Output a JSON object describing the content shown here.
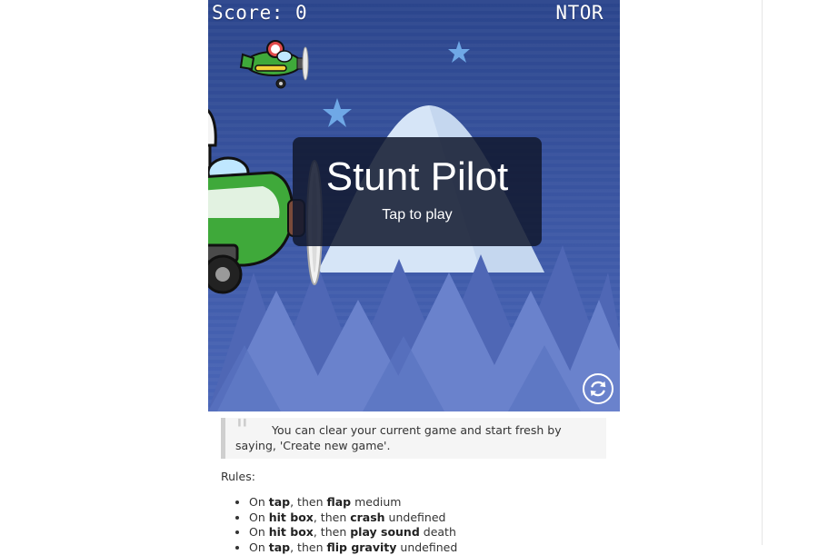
{
  "game": {
    "score_text": "Score: 0",
    "tag": "NTOR",
    "title": "Stunt Pilot",
    "subtitle": "Tap to play",
    "colors": {
      "sky_top": "#2b458c",
      "sky_bottom": "#4a66b8",
      "mountain": "#cfe0f5",
      "tree_dark": "#4f67b5",
      "tree_light": "#6a82cc",
      "star": "#6fa8e6",
      "plane_body": "#3fa93a",
      "panel": "#11182e"
    },
    "reset_icon": "refresh-icon"
  },
  "note": {
    "text": "You can clear your current game and start fresh by saying, 'Create new game'."
  },
  "rules": {
    "label": "Rules:",
    "items": [
      {
        "prefix": "On ",
        "trigger": "tap",
        "mid": ", then ",
        "action": "flap",
        "value": " medium"
      },
      {
        "prefix": "On ",
        "trigger": "hit box",
        "mid": ", then ",
        "action": "crash",
        "value": " undefined"
      },
      {
        "prefix": "On ",
        "trigger": "hit box",
        "mid": ", then ",
        "action": "play sound",
        "value": " death"
      },
      {
        "prefix": "On ",
        "trigger": "tap",
        "mid": ", then ",
        "action": "flip gravity",
        "value": " undefined"
      }
    ]
  }
}
